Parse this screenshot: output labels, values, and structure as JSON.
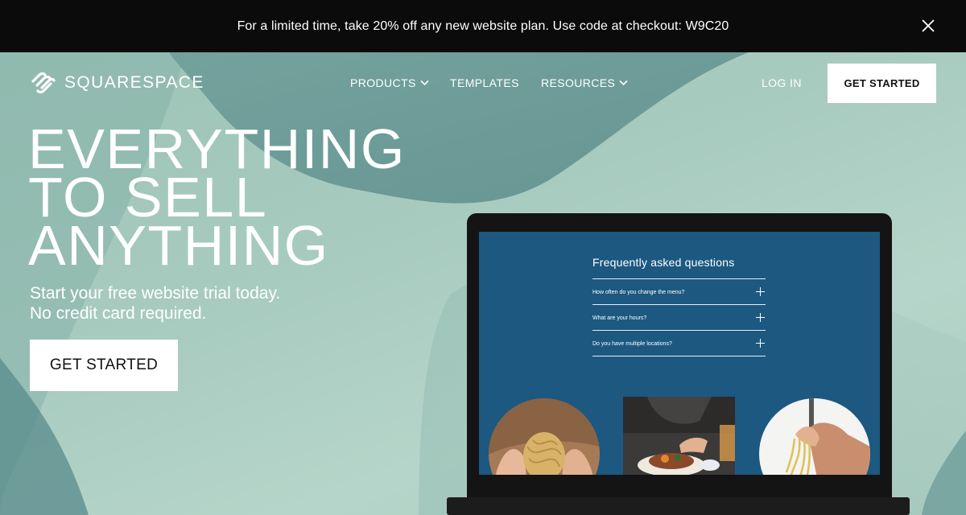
{
  "promo": {
    "text": "For a limited time, take 20% off any new website plan. Use code at checkout: W9C20"
  },
  "brand": {
    "name": "SQUARESPACE"
  },
  "nav": {
    "products": "PRODUCTS",
    "templates": "TEMPLATES",
    "resources": "RESOURCES",
    "login": "LOG IN",
    "cta": "GET STARTED"
  },
  "hero": {
    "headline": [
      "EVERYTHING",
      "TO SELL",
      "ANYTHING"
    ],
    "subline_1": "Start your free website trial today.",
    "subline_2": "No credit card required.",
    "cta": "GET STARTED"
  },
  "faq": {
    "title": "Frequently asked questions",
    "questions": [
      "How often do you change the menu?",
      "What are your hours?",
      "Do you have multiple locations?"
    ]
  },
  "colors": {
    "promo_bg": "#0b0b0b",
    "hero_bg": "#9fc4b9",
    "screen_bg": "#1d5880",
    "cta_bg": "#ffffff"
  }
}
